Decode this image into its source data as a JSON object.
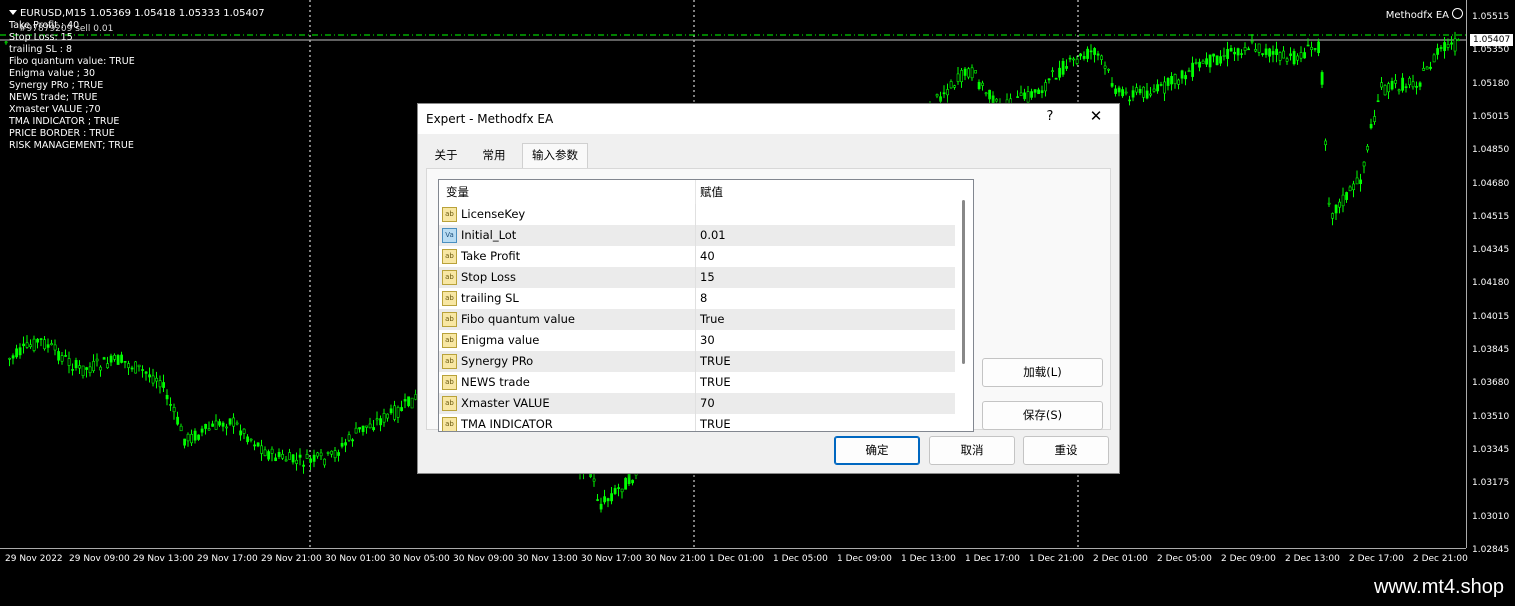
{
  "chart": {
    "title": "EURUSD,M15  1.05369 1.05418 1.05333 1.05407",
    "ea_name": "Methodfx EA",
    "overlap_text": "#97879209 sell 0.01",
    "info_lines": [
      "Take Profit : 40",
      "Stop Loss:  15",
      "trailing SL : 8",
      "Fibo quantum value: TRUE",
      "Enigma value ; 30",
      "Synergy PRo ; TRUE",
      "NEWS trade;  TRUE",
      "Xmaster VALUE ;70",
      "TMA INDICATOR ; TRUE",
      "PRICE BORDER : TRUE",
      "RISK MANAGEMENT; TRUE"
    ],
    "price_labels": [
      "1.05515",
      "1.05350",
      "1.05180",
      "1.05015",
      "1.04850",
      "1.04680",
      "1.04515",
      "1.04345",
      "1.04180",
      "1.04015",
      "1.03845",
      "1.03680",
      "1.03510",
      "1.03345",
      "1.03175",
      "1.03010",
      "1.02845"
    ],
    "current_price": "1.05407",
    "time_labels": [
      "29 Nov 2022",
      "29 Nov 09:00",
      "29 Nov 13:00",
      "29 Nov 17:00",
      "29 Nov 21:00",
      "30 Nov 01:00",
      "30 Nov 05:00",
      "30 Nov 09:00",
      "30 Nov 13:00",
      "30 Nov 17:00",
      "30 Nov 21:00",
      "1 Dec 01:00",
      "1 Dec 05:00",
      "1 Dec 09:00",
      "1 Dec 13:00",
      "1 Dec 17:00",
      "1 Dec 21:00",
      "2 Dec 01:00",
      "2 Dec 05:00",
      "2 Dec 09:00",
      "2 Dec 13:00",
      "2 Dec 17:00",
      "2 Dec 21:00"
    ],
    "colors": {
      "background": "#000000",
      "candles": "#00ff00",
      "axis_text": "#ffffff",
      "grid_day_separator": "#ffffff",
      "price_line": "#00ff00"
    }
  },
  "dialog": {
    "title": "Expert - Methodfx EA",
    "help_label": "?",
    "close_label": "✕",
    "tabs": [
      "关于",
      "常用",
      "输入参数"
    ],
    "active_tab": "输入参数",
    "grid_headers": {
      "variable": "变量",
      "value": "赋值"
    },
    "params": [
      {
        "icon": "ab",
        "name": "LicenseKey",
        "value": ""
      },
      {
        "icon": "Va",
        "name": "Initial_Lot",
        "value": "0.01"
      },
      {
        "icon": "ab",
        "name": "Take Profit",
        "value": "40"
      },
      {
        "icon": "ab",
        "name": "Stop Loss",
        "value": "15"
      },
      {
        "icon": "ab",
        "name": "trailing SL",
        "value": "8"
      },
      {
        "icon": "ab",
        "name": "Fibo quantum value",
        "value": "True"
      },
      {
        "icon": "ab",
        "name": "Enigma value",
        "value": "30"
      },
      {
        "icon": "ab",
        "name": "Synergy PRo",
        "value": "TRUE"
      },
      {
        "icon": "ab",
        "name": "NEWS trade",
        "value": "TRUE"
      },
      {
        "icon": "ab",
        "name": "Xmaster VALUE",
        "value": "70"
      },
      {
        "icon": "ab",
        "name": "TMA INDICATOR",
        "value": "TRUE"
      }
    ],
    "buttons": {
      "load": "加载(L)",
      "save": "保存(S)",
      "ok": "确定",
      "cancel": "取消",
      "reset": "重设"
    }
  },
  "watermark": "www.mt4.shop"
}
